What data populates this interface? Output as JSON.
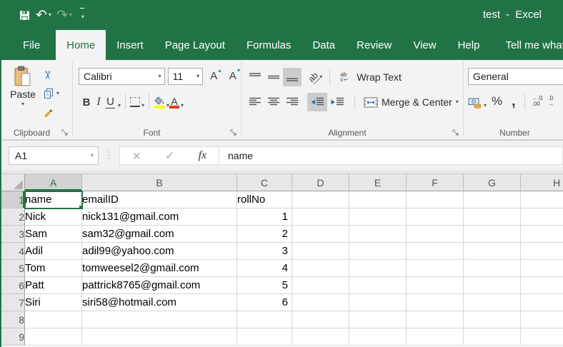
{
  "window": {
    "title": "test - Excel"
  },
  "tabs": [
    {
      "label": "File"
    },
    {
      "label": "Home"
    },
    {
      "label": "Insert"
    },
    {
      "label": "Page Layout"
    },
    {
      "label": "Formulas"
    },
    {
      "label": "Data"
    },
    {
      "label": "Review"
    },
    {
      "label": "View"
    },
    {
      "label": "Help"
    }
  ],
  "active_tab": "Home",
  "tell_me": {
    "label": "Tell me what yo"
  },
  "icons": {
    "save": "floppy-disk",
    "undo": "↶",
    "redo": "↷",
    "qat_menu": "▾",
    "dropdown": "▾",
    "cut": "✂",
    "dots": "⋮",
    "caret_up": "▴",
    "caret_down": "▾",
    "wrap_return": "↩",
    "select_all": "corner-triangle",
    "lightbulb": "bulb-outline"
  },
  "ribbon": {
    "clipboard": {
      "label": "Clipboard",
      "paste_label": "Paste"
    },
    "font": {
      "label": "Font",
      "family": "Calibri",
      "size": "11",
      "bold": "B",
      "italic": "I",
      "underline": "U",
      "grow_font_letter": "A",
      "shrink_font_letter": "A",
      "font_color_letter": "A"
    },
    "alignment": {
      "label": "Alignment",
      "orientation_letters": "ab",
      "wrap_text_label": "Wrap Text",
      "merge_center_label": "Merge & Center",
      "wrap_icon_top": "ab",
      "wrap_icon_bottom": "c"
    },
    "number": {
      "label": "Number",
      "format": "General",
      "percent": "%",
      "comma": ",",
      "inc_arrow": "←",
      "inc_top": ".0",
      "inc_bottom": ".00",
      "dec_top": ".0",
      "dec_arrow": "→"
    }
  },
  "formula_bar": {
    "name_box": "A1",
    "cancel": "×",
    "enter": "✓",
    "fx": "fx",
    "content": "name"
  },
  "sheet": {
    "selected_cell": "A1",
    "columns": [
      "A",
      "B",
      "C",
      "D",
      "E",
      "F",
      "G",
      "H"
    ],
    "rows": [
      {
        "num": "1",
        "cells": [
          "name",
          "emailID",
          "rollNo",
          "",
          "",
          "",
          "",
          ""
        ]
      },
      {
        "num": "2",
        "cells": [
          "Nick",
          "nick131@gmail.com",
          "1",
          "",
          "",
          "",
          "",
          ""
        ]
      },
      {
        "num": "3",
        "cells": [
          "Sam",
          "sam32@gmail.com",
          "2",
          "",
          "",
          "",
          "",
          ""
        ]
      },
      {
        "num": "4",
        "cells": [
          "Adil",
          "adil99@yahoo.com",
          "3",
          "",
          "",
          "",
          "",
          ""
        ]
      },
      {
        "num": "5",
        "cells": [
          "Tom",
          "tomweesel2@gmail.com",
          "4",
          "",
          "",
          "",
          "",
          ""
        ]
      },
      {
        "num": "6",
        "cells": [
          "Patt",
          "pattrick8765@gmail.com",
          "5",
          "",
          "",
          "",
          "",
          ""
        ]
      },
      {
        "num": "7",
        "cells": [
          "Siri",
          "siri58@hotmail.com",
          "6",
          "",
          "",
          "",
          "",
          ""
        ]
      },
      {
        "num": "8",
        "cells": [
          "",
          "",
          "",
          "",
          "",
          "",
          "",
          ""
        ]
      },
      {
        "num": "9",
        "cells": [
          "",
          "",
          "",
          "",
          "",
          "",
          "",
          ""
        ]
      }
    ]
  },
  "colors": {
    "accent_green": "#217346",
    "fill_yellow": "#ffff00",
    "font_red": "#e03b24",
    "icon_blue": "#2e75b6"
  }
}
